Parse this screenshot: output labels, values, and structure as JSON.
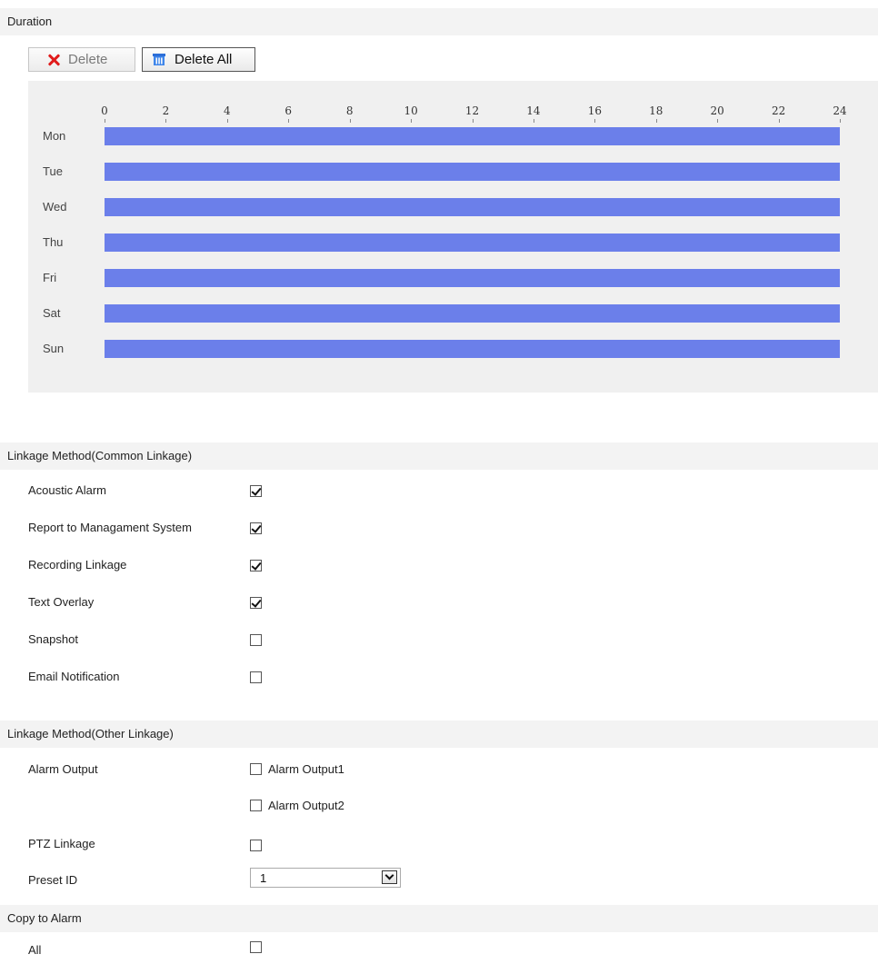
{
  "duration": {
    "header": "Duration",
    "delete_label": "Delete",
    "delete_all_label": "Delete All",
    "hours": [
      "0",
      "2",
      "4",
      "6",
      "8",
      "10",
      "12",
      "14",
      "16",
      "18",
      "20",
      "22",
      "24"
    ],
    "days": [
      "Mon",
      "Tue",
      "Wed",
      "Thu",
      "Fri",
      "Sat",
      "Sun"
    ],
    "bar_color": "#6b7fea",
    "schedule_start_hour": 0,
    "schedule_end_hour": 24
  },
  "common_linkage": {
    "header": "Linkage Method(Common Linkage)",
    "items": [
      {
        "label": "Acoustic Alarm",
        "checked": true
      },
      {
        "label": "Report to Managament System",
        "checked": true
      },
      {
        "label": "Recording Linkage",
        "checked": true
      },
      {
        "label": "Text Overlay",
        "checked": true
      },
      {
        "label": "Snapshot",
        "checked": false
      },
      {
        "label": "Email Notification",
        "checked": false
      }
    ]
  },
  "other_linkage": {
    "header": "Linkage Method(Other Linkage)",
    "alarm_output_label": "Alarm Output",
    "alarm_outputs": [
      {
        "label": "Alarm Output1",
        "checked": false
      },
      {
        "label": "Alarm Output2",
        "checked": false
      }
    ],
    "ptz_label": "PTZ Linkage",
    "ptz_checked": false,
    "preset_label": "Preset ID",
    "preset_value": "1"
  },
  "copy_to_alarm": {
    "header": "Copy to Alarm",
    "all_label": "All",
    "all_checked": false
  }
}
